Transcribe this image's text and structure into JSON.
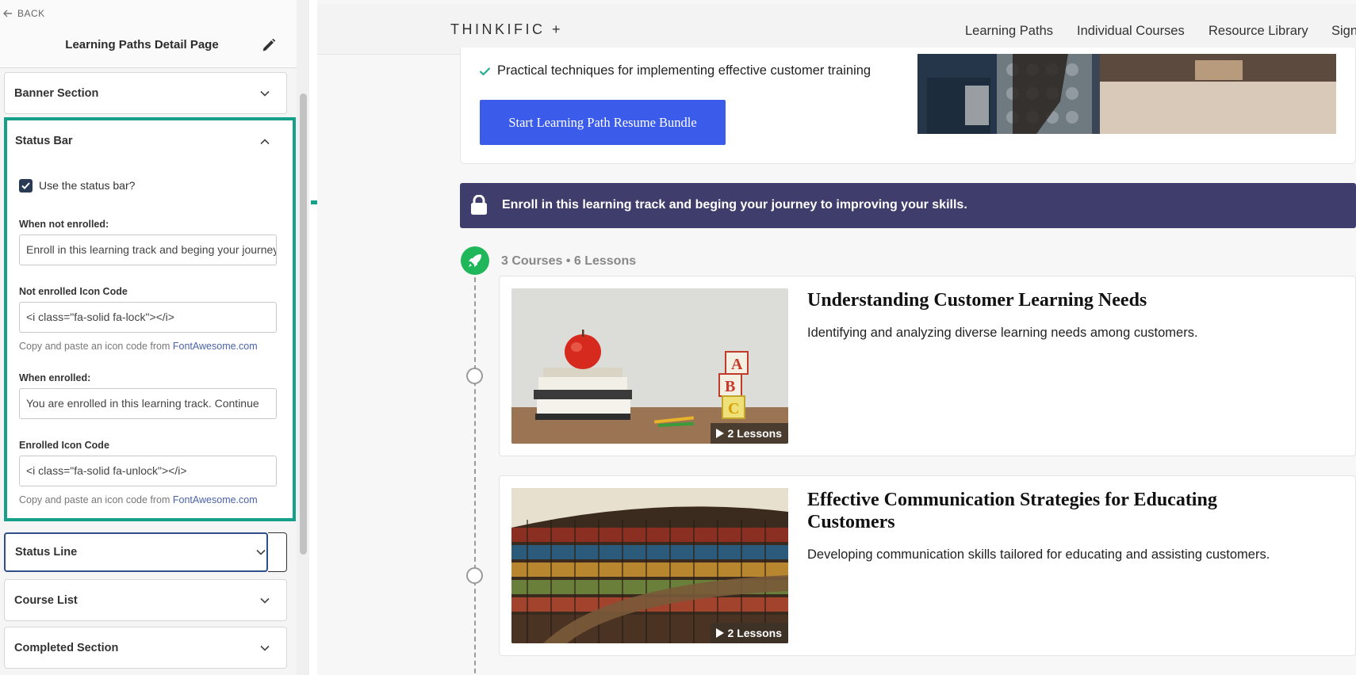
{
  "editor": {
    "back_label": "BACK",
    "page_title": "Learning Paths Detail Page",
    "sections": {
      "banner": "Banner Section",
      "status_bar": "Status Bar",
      "status_line": "Status Line",
      "course_list": "Course List",
      "completed": "Completed Section"
    },
    "status_bar_panel": {
      "use_checkbox_label": "Use the status bar?",
      "use_checked": true,
      "not_enrolled_label": "When not enrolled:",
      "not_enrolled_value": "Enroll in this learning track and beging your journey to improving your skills.",
      "not_enrolled_icon_label": "Not enrolled Icon Code",
      "not_enrolled_icon_value": "<i class=\"fa-solid fa-lock\"></i>",
      "help_prefix": "Copy and paste an icon code from",
      "help_link": "FontAwesome.com",
      "enrolled_label": "When enrolled:",
      "enrolled_value": "You are enrolled in this learning track. Continue",
      "enrolled_icon_label": "Enrolled Icon Code",
      "enrolled_icon_value": "<i class=\"fa-solid fa-unlock\"></i>"
    }
  },
  "preview": {
    "logo": "THINKIFIC +",
    "nav": [
      "Learning Paths",
      "Individual Courses",
      "Resource Library",
      "Sign"
    ],
    "hero": {
      "bullet": "Practical techniques for implementing effective customer training",
      "cta": "Start Learning Path Resume Bundle"
    },
    "status_bar_text": "Enroll in this learning track and beging your journey to improving your skills.",
    "counts": "3 Courses • 6 Lessons",
    "courses": [
      {
        "title": "Understanding Customer Learning Needs",
        "description": "Identifying and analyzing diverse learning needs among customers.",
        "lessons": "2 Lessons"
      },
      {
        "title": "Effective Communication Strategies for Educating Customers",
        "description": "Developing communication skills tailored for educating and assisting customers.",
        "lessons": "2 Lessons"
      }
    ]
  },
  "colors": {
    "highlight": "#16a08a",
    "status_bar_bg": "#3f3d6b",
    "cta_blue": "#3b5bea",
    "rocket_green": "#1fb75a",
    "link": "#4a62a8"
  },
  "icons": [
    "arrow-left-icon",
    "pencil-icon",
    "chevron-down-icon",
    "chevron-up-icon",
    "check-icon",
    "lock-icon",
    "rocket-icon",
    "play-icon",
    "arrow-right-icon"
  ]
}
